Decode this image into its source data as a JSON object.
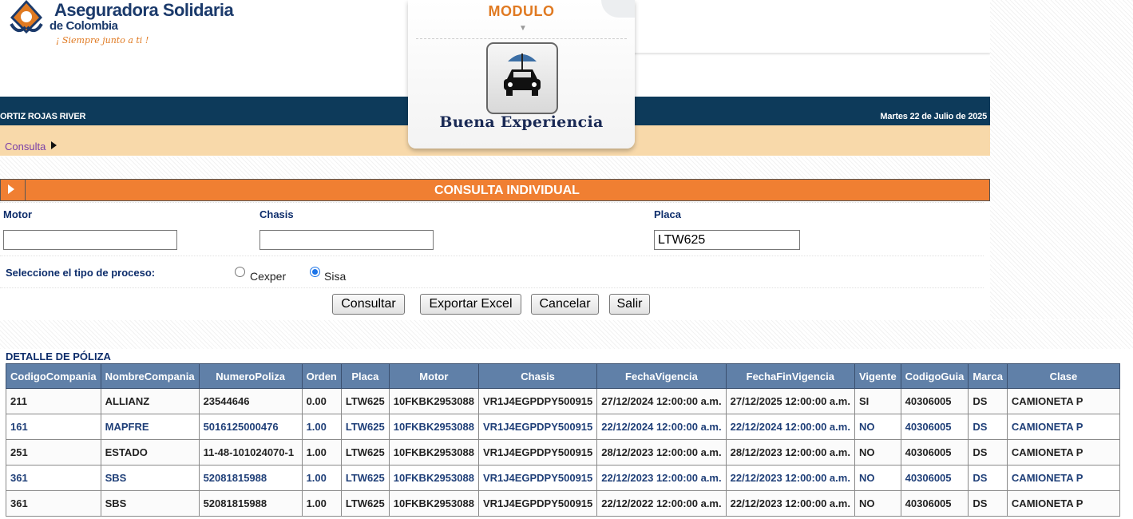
{
  "header": {
    "logo_text": "Aseguradora Solidaria",
    "logo_subtext": "de Colombia",
    "logo_slogan": "¡ Siempre junto a ti !",
    "user_name": "ORTIZ ROJAS RIVER",
    "date_text": "Martes 22 de Julio de 2025",
    "breadcrumb": "Consulta"
  },
  "module": {
    "title": "MODULO",
    "label": "Buena Experiencia",
    "icon": "car-umbrella-icon"
  },
  "consulta": {
    "title": "CONSULTA INDIVIDUAL",
    "motor_label": "Motor",
    "motor_value": "",
    "chasis_label": "Chasis",
    "chasis_value": "",
    "placa_label": "Placa",
    "placa_value": "LTW625",
    "proceso_label": "Seleccione el tipo de proceso:",
    "radio_cexper": "Cexper",
    "radio_sisa": "Sisa",
    "selected_radio": "Sisa",
    "buttons": {
      "consultar": "Consultar",
      "exportar": "Exportar Excel",
      "cancelar": "Cancelar",
      "salir": "Salir"
    }
  },
  "detalle": {
    "title": "DETALLE DE PÓLIZA",
    "columns": [
      "CodigoCompania",
      "NombreCompania",
      "NumeroPoliza",
      "Orden",
      "Placa",
      "Motor",
      "Chasis",
      "FechaVigencia",
      "FechaFinVigencia",
      "Vigente",
      "CodigoGuia",
      "Marca",
      "Clase"
    ],
    "rows": [
      [
        "211",
        "ALLIANZ",
        "23544646",
        "0.00",
        "LTW625",
        "10FKBK2953088",
        "VR1J4EGPDPY500915",
        "27/12/2024 12:00:00 a.m.",
        "27/12/2025 12:00:00 a.m.",
        "SI",
        "40306005",
        "DS",
        "CAMIONETA P"
      ],
      [
        "161",
        "MAPFRE",
        "5016125000476",
        "1.00",
        "LTW625",
        "10FKBK2953088",
        "VR1J4EGPDPY500915",
        "22/12/2024 12:00:00 a.m.",
        "22/12/2024 12:00:00 a.m.",
        "NO",
        "40306005",
        "DS",
        "CAMIONETA P"
      ],
      [
        "251",
        "ESTADO",
        "11-48-101024070-1",
        "1.00",
        "LTW625",
        "10FKBK2953088",
        "VR1J4EGPDPY500915",
        "28/12/2023 12:00:00 a.m.",
        "28/12/2023 12:00:00 a.m.",
        "NO",
        "40306005",
        "DS",
        "CAMIONETA P"
      ],
      [
        "361",
        "SBS",
        "52081815988",
        "1.00",
        "LTW625",
        "10FKBK2953088",
        "VR1J4EGPDPY500915",
        "22/12/2023 12:00:00 a.m.",
        "22/12/2023 12:00:00 a.m.",
        "NO",
        "40306005",
        "DS",
        "CAMIONETA P"
      ],
      [
        "361",
        "SBS",
        "52081815988",
        "1.00",
        "LTW625",
        "10FKBK2953088",
        "VR1J4EGPDPY500915",
        "22/12/2022 12:00:00 a.m.",
        "22/12/2023 12:00:00 a.m.",
        "NO",
        "40306005",
        "DS",
        "CAMIONETA P"
      ]
    ]
  },
  "colors": {
    "navbar": "#0d3a5a",
    "accent_orange": "#f07f32",
    "table_header": "#6080a8",
    "label_blue": "#0d2d6b"
  }
}
